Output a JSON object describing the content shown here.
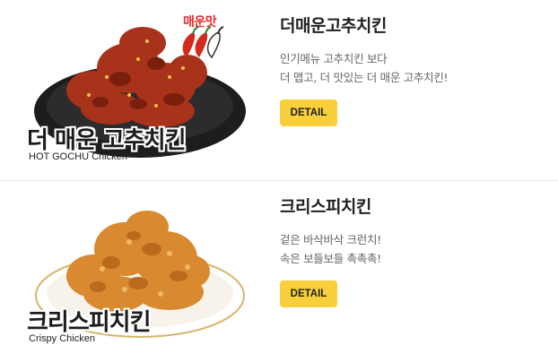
{
  "menu": [
    {
      "overlay_title": "더 매운 고추치킨",
      "overlay_subtitle": "HOT GOCHU Chicken",
      "badge": "매운맛",
      "name": "더매운고추치킨",
      "description_lines": [
        "인기메뉴 고추치킨 보다",
        "더 맵고, 더 맛있는 더 매운 고추치킨!"
      ],
      "button_label": "DETAIL"
    },
    {
      "overlay_title": "크리스피치킨",
      "overlay_subtitle": "Crispy Chicken",
      "name": "크리스피치킨",
      "description_lines": [
        "겉은 바삭바삭 크런치!",
        "속은 보들보들 촉촉촉!"
      ],
      "button_label": "DETAIL"
    }
  ],
  "colors": {
    "button": "#f9cf3c",
    "badge_text": "#e52b2b",
    "pepper_red": "#d42a1e",
    "plate_dark": "#1d1d1d",
    "spicy_chicken": "#a8321a",
    "crispy_chicken": "#d9892f"
  }
}
